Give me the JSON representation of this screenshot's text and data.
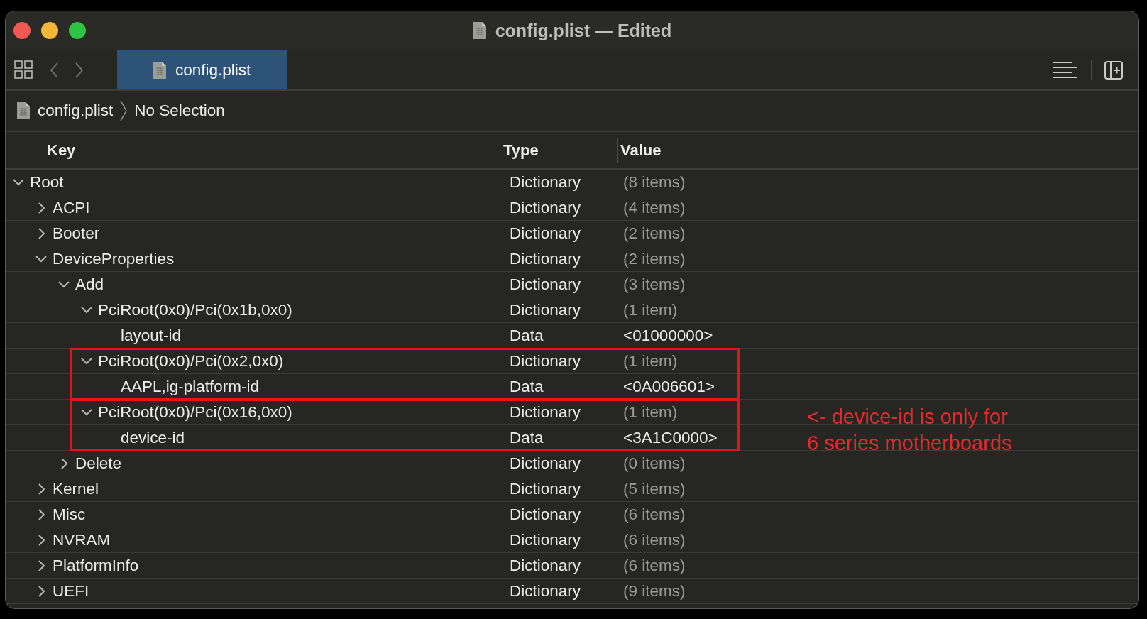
{
  "window": {
    "title": "config.plist — Edited"
  },
  "tabs": [
    {
      "label": "config.plist",
      "selected": true
    }
  ],
  "breadcrumb": [
    "config.plist",
    "No Selection"
  ],
  "columns": [
    "Key",
    "Type",
    "Value"
  ],
  "tree": [
    {
      "key": "Root",
      "type": "Dictionary",
      "value": "(8 items)",
      "kind": "dictionary",
      "expanded": true,
      "highlighted": false,
      "children": [
        {
          "key": "ACPI",
          "type": "Dictionary",
          "value": "(4 items)",
          "kind": "dictionary",
          "expanded": false,
          "highlighted": false
        },
        {
          "key": "Booter",
          "type": "Dictionary",
          "value": "(2 items)",
          "kind": "dictionary",
          "expanded": false,
          "highlighted": false
        },
        {
          "key": "DeviceProperties",
          "type": "Dictionary",
          "value": "(2 items)",
          "kind": "dictionary",
          "expanded": true,
          "highlighted": false,
          "children": [
            {
              "key": "Add",
              "type": "Dictionary",
              "value": "(3 items)",
              "kind": "dictionary",
              "expanded": true,
              "highlighted": false,
              "children": [
                {
                  "key": "PciRoot(0x0)/Pci(0x1b,0x0)",
                  "type": "Dictionary",
                  "value": "(1 item)",
                  "kind": "dictionary",
                  "expanded": true,
                  "highlighted": false,
                  "children": [
                    {
                      "key": "layout-id",
                      "type": "Data",
                      "value": "<01000000>",
                      "kind": "data",
                      "highlighted": false
                    }
                  ]
                },
                {
                  "key": "PciRoot(0x0)/Pci(0x2,0x0)",
                  "type": "Dictionary",
                  "value": "(1 item)",
                  "kind": "dictionary",
                  "expanded": true,
                  "highlighted": true,
                  "children": [
                    {
                      "key": "AAPL,ig-platform-id",
                      "type": "Data",
                      "value": "<0A006601>",
                      "kind": "data",
                      "highlighted": false
                    }
                  ]
                },
                {
                  "key": "PciRoot(0x0)/Pci(0x16,0x0)",
                  "type": "Dictionary",
                  "value": "(1 item)",
                  "kind": "dictionary",
                  "expanded": true,
                  "highlighted": true,
                  "note": "<- device-id is only for\n6 series motherboards",
                  "children": [
                    {
                      "key": "device-id",
                      "type": "Data",
                      "value": "<3A1C0000>",
                      "kind": "data",
                      "highlighted": false
                    }
                  ]
                }
              ]
            },
            {
              "key": "Delete",
              "type": "Dictionary",
              "value": "(0 items)",
              "kind": "dictionary",
              "expanded": false,
              "highlighted": false
            }
          ]
        },
        {
          "key": "Kernel",
          "type": "Dictionary",
          "value": "(5 items)",
          "kind": "dictionary",
          "expanded": false,
          "highlighted": false
        },
        {
          "key": "Misc",
          "type": "Dictionary",
          "value": "(6 items)",
          "kind": "dictionary",
          "expanded": false,
          "highlighted": false
        },
        {
          "key": "NVRAM",
          "type": "Dictionary",
          "value": "(6 items)",
          "kind": "dictionary",
          "expanded": false,
          "highlighted": false
        },
        {
          "key": "PlatformInfo",
          "type": "Dictionary",
          "value": "(6 items)",
          "kind": "dictionary",
          "expanded": false,
          "highlighted": false
        },
        {
          "key": "UEFI",
          "type": "Dictionary",
          "value": "(9 items)",
          "kind": "dictionary",
          "expanded": false,
          "highlighted": false
        }
      ]
    }
  ]
}
